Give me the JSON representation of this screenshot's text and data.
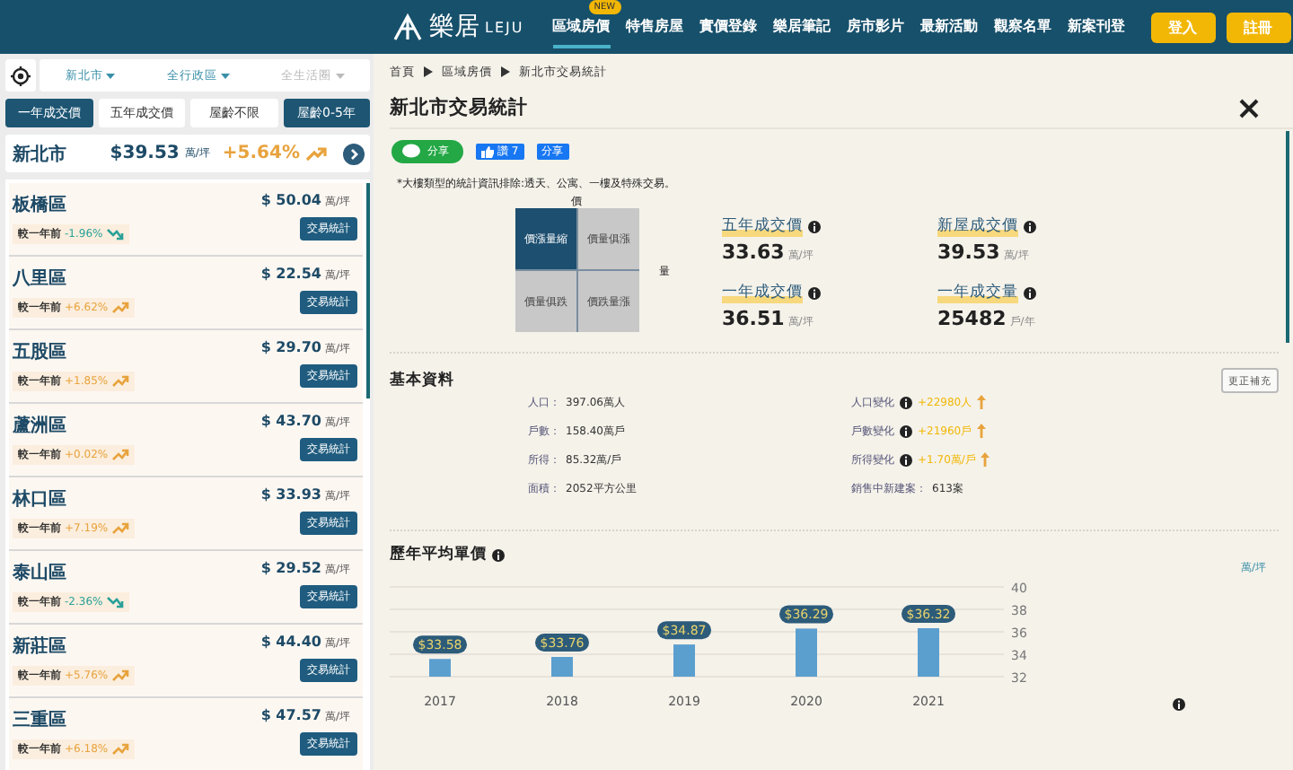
{
  "header": {
    "logo": "樂居",
    "logo_sub": "LEJU",
    "nav": [
      {
        "label": "區域房價",
        "selected": true,
        "badge": "NEW"
      },
      {
        "label": "特售房屋",
        "selected": false
      },
      {
        "label": "實價登錄",
        "selected": false
      },
      {
        "label": "樂居筆記",
        "selected": false
      },
      {
        "label": "房市影片",
        "selected": false
      },
      {
        "label": "最新活動",
        "selected": false
      },
      {
        "label": "觀察名單",
        "selected": false
      },
      {
        "label": "新案刊登",
        "selected": false
      }
    ],
    "buttons": [
      "登入",
      "註冊"
    ]
  },
  "sidebar": {
    "filters": [
      {
        "label": "新北市",
        "disabled": false
      },
      {
        "label": "全行政區",
        "disabled": false
      },
      {
        "label": "全生活圈",
        "disabled": true
      }
    ],
    "tabs": [
      {
        "label": "一年成交價",
        "selected": true
      },
      {
        "label": "五年成交價",
        "selected": false
      },
      {
        "label": "屋齡不限",
        "selected": false
      },
      {
        "label": "屋齡0-5年",
        "selected": true
      }
    ],
    "summary": {
      "name": "新北市",
      "price": "$39.53",
      "unit": "萬/坪",
      "change": "+5.64%",
      "kind": "up"
    },
    "districts": [
      {
        "name": "板橋區",
        "price": "$ 50.04",
        "unit": "萬/坪",
        "compare": "較一年前",
        "change": "-1.96%",
        "kind": "down",
        "button": "交易統計"
      },
      {
        "name": "八里區",
        "price": "$ 22.54",
        "unit": "萬/坪",
        "compare": "較一年前",
        "change": "+6.62%",
        "kind": "up",
        "button": "交易統計"
      },
      {
        "name": "五股區",
        "price": "$ 29.70",
        "unit": "萬/坪",
        "compare": "較一年前",
        "change": "+1.85%",
        "kind": "up",
        "button": "交易統計"
      },
      {
        "name": "蘆洲區",
        "price": "$ 43.70",
        "unit": "萬/坪",
        "compare": "較一年前",
        "change": "+0.02%",
        "kind": "up",
        "button": "交易統計"
      },
      {
        "name": "林口區",
        "price": "$ 33.93",
        "unit": "萬/坪",
        "compare": "較一年前",
        "change": "+7.19%",
        "kind": "up",
        "button": "交易統計"
      },
      {
        "name": "泰山區",
        "price": "$ 29.52",
        "unit": "萬/坪",
        "compare": "較一年前",
        "change": "-2.36%",
        "kind": "down",
        "button": "交易統計"
      },
      {
        "name": "新莊區",
        "price": "$ 44.40",
        "unit": "萬/坪",
        "compare": "較一年前",
        "change": "+5.76%",
        "kind": "up",
        "button": "交易統計"
      },
      {
        "name": "三重區",
        "price": "$ 47.57",
        "unit": "萬/坪",
        "compare": "較一年前",
        "change": "+6.18%",
        "kind": "up",
        "button": "交易統計"
      }
    ]
  },
  "breadcrumb": [
    "首頁",
    "區域房價",
    "新北市交易統計"
  ],
  "title": "新北市交易統計",
  "share": {
    "line": "分享",
    "like": "讚 7",
    "fb": "分享"
  },
  "note": "*大樓類型的統計資訊排除:透天、公寓、一樓及特殊交易。",
  "quadrant": {
    "y_axis": "價",
    "x_axis": "量",
    "cells": [
      {
        "label": "價漲量縮",
        "selected": true
      },
      {
        "label": "價量俱漲",
        "selected": false
      },
      {
        "label": "價量俱跌",
        "selected": false
      },
      {
        "label": "價跌量漲",
        "selected": false
      }
    ]
  },
  "stats": [
    {
      "label": "五年成交價",
      "value": "33.63",
      "unit": "萬/坪"
    },
    {
      "label": "新屋成交價",
      "value": "39.53",
      "unit": "萬/坪"
    },
    {
      "label": "一年成交價",
      "value": "36.51",
      "unit": "萬/坪"
    },
    {
      "label": "一年成交量",
      "value": "25482",
      "unit": "戶/年"
    }
  ],
  "basic": {
    "title": "基本資料",
    "button": "更正補充",
    "left": [
      {
        "label": "人口：",
        "value": "397.06萬人"
      },
      {
        "label": "戶數：",
        "value": "158.40萬戶"
      },
      {
        "label": "所得：",
        "value": "85.32萬/戶"
      },
      {
        "label": "面積：",
        "value": "2052平方公里"
      }
    ],
    "right": [
      {
        "kind": "change",
        "label": "人口變化",
        "value": "+22980人"
      },
      {
        "kind": "change",
        "label": "戶數變化",
        "value": "+21960戶"
      },
      {
        "kind": "change",
        "label": "所得變化",
        "value": "+1.70萬/戶"
      },
      {
        "kind": "plain",
        "label": "銷售中新建案：",
        "value": "613案"
      }
    ]
  },
  "history": {
    "title": "歷年平均單價",
    "unit": "萬/坪",
    "chart_data": {
      "type": "bar",
      "categories": [
        "2017",
        "2018",
        "2019",
        "2020",
        "2021"
      ],
      "values": [
        33.58,
        33.76,
        34.87,
        36.29,
        36.32
      ],
      "grid": true,
      "ylim": [
        32,
        40
      ],
      "yticks": [
        32,
        34,
        36,
        38,
        40
      ],
      "value_labels": [
        "$33.58",
        "$33.76",
        "$34.87",
        "$36.29",
        "$36.32"
      ]
    }
  }
}
